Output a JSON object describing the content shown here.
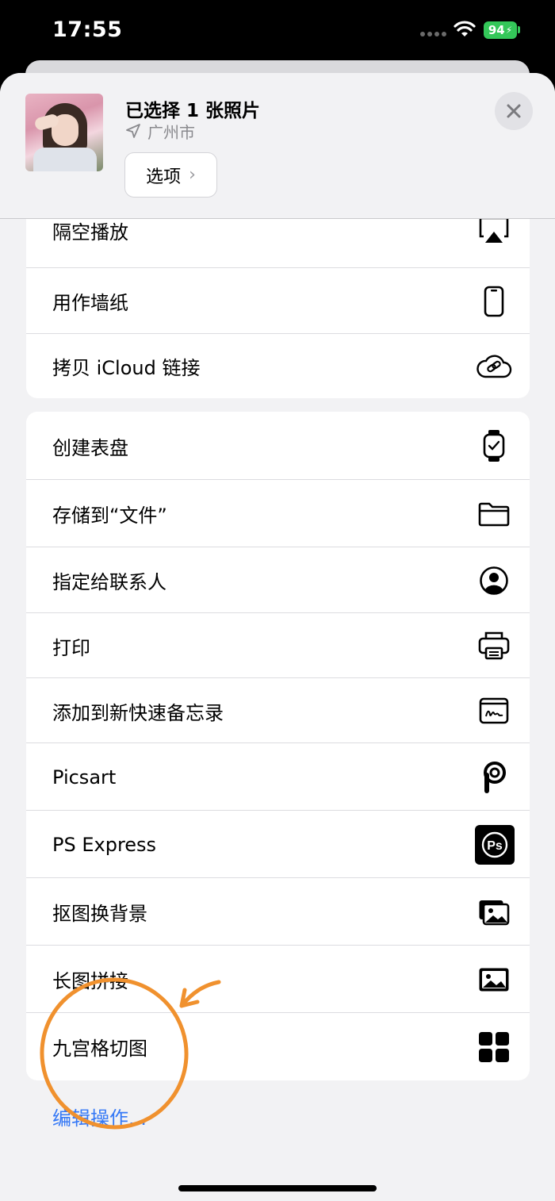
{
  "status_bar": {
    "time": "17:55",
    "battery": "94"
  },
  "header": {
    "title": "已选择 1 张照片",
    "location": "广州市",
    "options_label": "选项"
  },
  "group1": [
    {
      "label": "隔空播放",
      "icon": "airplay-icon"
    },
    {
      "label": "用作墙纸",
      "icon": "iphone-icon"
    },
    {
      "label": "拷贝 iCloud 链接",
      "icon": "icloud-link-icon"
    }
  ],
  "group2": [
    {
      "label": "创建表盘",
      "icon": "watch-icon"
    },
    {
      "label": "存储到“文件”",
      "icon": "folder-icon"
    },
    {
      "label": "指定给联系人",
      "icon": "contact-icon"
    },
    {
      "label": "打印",
      "icon": "printer-icon"
    },
    {
      "label": "添加到新快速备忘录",
      "icon": "quick-note-icon"
    },
    {
      "label": "Picsart",
      "icon": "picsart-icon"
    },
    {
      "label": "PS Express",
      "icon": "ps-express-icon"
    },
    {
      "label": "抠图换背景",
      "icon": "photos-stack-icon"
    },
    {
      "label": "长图拼接",
      "icon": "image-icon"
    },
    {
      "label": "九宫格切图",
      "icon": "grid-icon"
    }
  ],
  "edit_actions": "编辑操作...",
  "colors": {
    "accent": "#3478f6",
    "battery": "#34c759",
    "annotation": "#f0912e"
  }
}
